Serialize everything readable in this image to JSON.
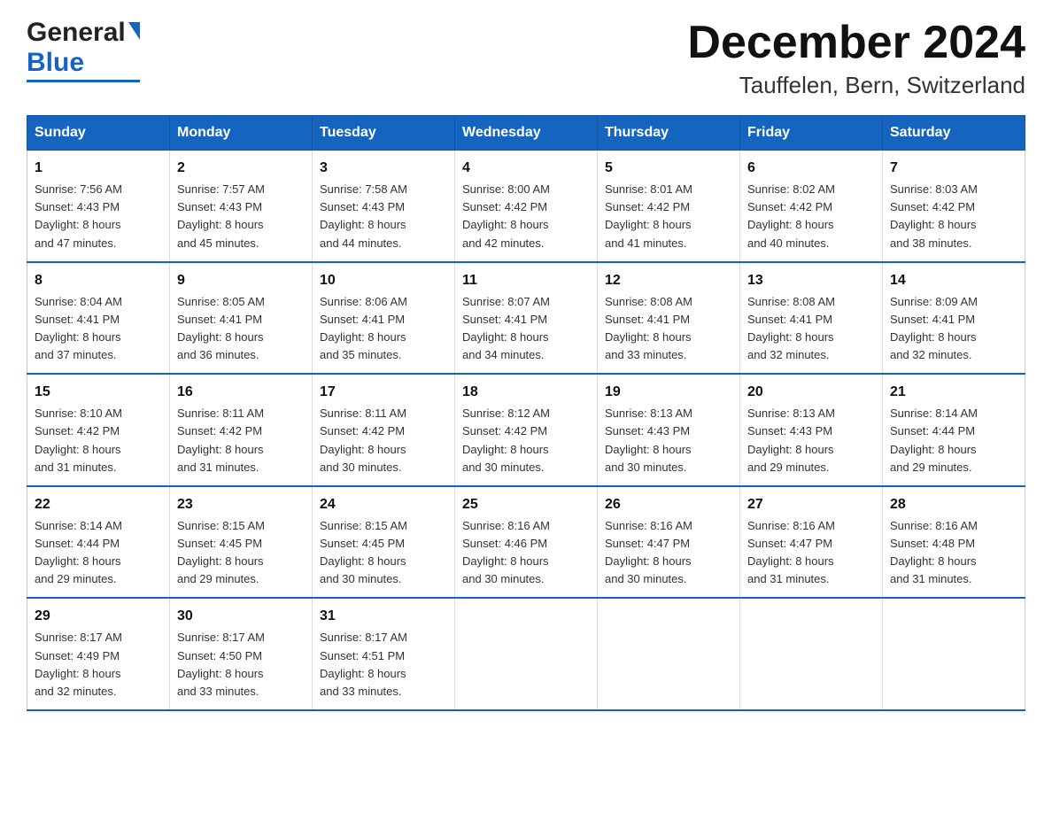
{
  "header": {
    "logo_general": "General",
    "logo_blue": "Blue",
    "title": "December 2024",
    "subtitle": "Tauffelen, Bern, Switzerland"
  },
  "days_of_week": [
    "Sunday",
    "Monday",
    "Tuesday",
    "Wednesday",
    "Thursday",
    "Friday",
    "Saturday"
  ],
  "weeks": [
    [
      {
        "day": "1",
        "sunrise": "7:56 AM",
        "sunset": "4:43 PM",
        "daylight": "8 hours and 47 minutes."
      },
      {
        "day": "2",
        "sunrise": "7:57 AM",
        "sunset": "4:43 PM",
        "daylight": "8 hours and 45 minutes."
      },
      {
        "day": "3",
        "sunrise": "7:58 AM",
        "sunset": "4:43 PM",
        "daylight": "8 hours and 44 minutes."
      },
      {
        "day": "4",
        "sunrise": "8:00 AM",
        "sunset": "4:42 PM",
        "daylight": "8 hours and 42 minutes."
      },
      {
        "day": "5",
        "sunrise": "8:01 AM",
        "sunset": "4:42 PM",
        "daylight": "8 hours and 41 minutes."
      },
      {
        "day": "6",
        "sunrise": "8:02 AM",
        "sunset": "4:42 PM",
        "daylight": "8 hours and 40 minutes."
      },
      {
        "day": "7",
        "sunrise": "8:03 AM",
        "sunset": "4:42 PM",
        "daylight": "8 hours and 38 minutes."
      }
    ],
    [
      {
        "day": "8",
        "sunrise": "8:04 AM",
        "sunset": "4:41 PM",
        "daylight": "8 hours and 37 minutes."
      },
      {
        "day": "9",
        "sunrise": "8:05 AM",
        "sunset": "4:41 PM",
        "daylight": "8 hours and 36 minutes."
      },
      {
        "day": "10",
        "sunrise": "8:06 AM",
        "sunset": "4:41 PM",
        "daylight": "8 hours and 35 minutes."
      },
      {
        "day": "11",
        "sunrise": "8:07 AM",
        "sunset": "4:41 PM",
        "daylight": "8 hours and 34 minutes."
      },
      {
        "day": "12",
        "sunrise": "8:08 AM",
        "sunset": "4:41 PM",
        "daylight": "8 hours and 33 minutes."
      },
      {
        "day": "13",
        "sunrise": "8:08 AM",
        "sunset": "4:41 PM",
        "daylight": "8 hours and 32 minutes."
      },
      {
        "day": "14",
        "sunrise": "8:09 AM",
        "sunset": "4:41 PM",
        "daylight": "8 hours and 32 minutes."
      }
    ],
    [
      {
        "day": "15",
        "sunrise": "8:10 AM",
        "sunset": "4:42 PM",
        "daylight": "8 hours and 31 minutes."
      },
      {
        "day": "16",
        "sunrise": "8:11 AM",
        "sunset": "4:42 PM",
        "daylight": "8 hours and 31 minutes."
      },
      {
        "day": "17",
        "sunrise": "8:11 AM",
        "sunset": "4:42 PM",
        "daylight": "8 hours and 30 minutes."
      },
      {
        "day": "18",
        "sunrise": "8:12 AM",
        "sunset": "4:42 PM",
        "daylight": "8 hours and 30 minutes."
      },
      {
        "day": "19",
        "sunrise": "8:13 AM",
        "sunset": "4:43 PM",
        "daylight": "8 hours and 30 minutes."
      },
      {
        "day": "20",
        "sunrise": "8:13 AM",
        "sunset": "4:43 PM",
        "daylight": "8 hours and 29 minutes."
      },
      {
        "day": "21",
        "sunrise": "8:14 AM",
        "sunset": "4:44 PM",
        "daylight": "8 hours and 29 minutes."
      }
    ],
    [
      {
        "day": "22",
        "sunrise": "8:14 AM",
        "sunset": "4:44 PM",
        "daylight": "8 hours and 29 minutes."
      },
      {
        "day": "23",
        "sunrise": "8:15 AM",
        "sunset": "4:45 PM",
        "daylight": "8 hours and 29 minutes."
      },
      {
        "day": "24",
        "sunrise": "8:15 AM",
        "sunset": "4:45 PM",
        "daylight": "8 hours and 30 minutes."
      },
      {
        "day": "25",
        "sunrise": "8:16 AM",
        "sunset": "4:46 PM",
        "daylight": "8 hours and 30 minutes."
      },
      {
        "day": "26",
        "sunrise": "8:16 AM",
        "sunset": "4:47 PM",
        "daylight": "8 hours and 30 minutes."
      },
      {
        "day": "27",
        "sunrise": "8:16 AM",
        "sunset": "4:47 PM",
        "daylight": "8 hours and 31 minutes."
      },
      {
        "day": "28",
        "sunrise": "8:16 AM",
        "sunset": "4:48 PM",
        "daylight": "8 hours and 31 minutes."
      }
    ],
    [
      {
        "day": "29",
        "sunrise": "8:17 AM",
        "sunset": "4:49 PM",
        "daylight": "8 hours and 32 minutes."
      },
      {
        "day": "30",
        "sunrise": "8:17 AM",
        "sunset": "4:50 PM",
        "daylight": "8 hours and 33 minutes."
      },
      {
        "day": "31",
        "sunrise": "8:17 AM",
        "sunset": "4:51 PM",
        "daylight": "8 hours and 33 minutes."
      },
      null,
      null,
      null,
      null
    ]
  ],
  "labels": {
    "sunrise": "Sunrise:",
    "sunset": "Sunset:",
    "daylight": "Daylight:"
  }
}
